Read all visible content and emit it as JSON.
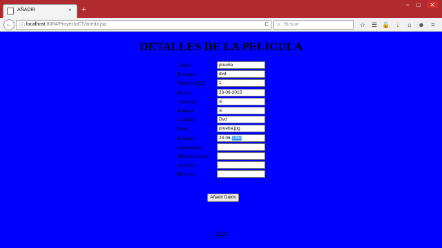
{
  "browser": {
    "tab_title": "AÑADIR",
    "tab_close": "×",
    "new_tab": "+",
    "url_host": "localhost",
    "url_path": ":8084/ProyectoCT/anedir.jsp",
    "search_placeholder": "Buscar",
    "window_buttons": {
      "minimize": "−",
      "maximize": "□",
      "close": "✕"
    }
  },
  "icons": {
    "back": "←",
    "info": "ⓘ",
    "reload": "C",
    "search": "⌕",
    "bookmark": "☆",
    "reading": "☰",
    "lock": "🔒",
    "download": "↓",
    "home": "⌂",
    "pocket": "☻",
    "menu": "≡"
  },
  "page": {
    "title": "DETALLES DE LA PELICULA",
    "submit_label": "Añadir Datos",
    "back_link": "Inicio"
  },
  "form": {
    "fields": [
      {
        "label": "Titulo:",
        "value": "prueba"
      },
      {
        "label": "Formato:",
        "value": "dvd"
      },
      {
        "label": "NumeroCDS:",
        "value": "1"
      },
      {
        "label": "Fecha:",
        "value": "23-06-2015"
      },
      {
        "label": "Caratula:",
        "value": "si"
      },
      {
        "label": "Imagen:",
        "value": "si"
      },
      {
        "label": "Calidad:",
        "value": "Dvd"
      },
      {
        "label": "Foto:",
        "value": "prueba.jpg"
      },
      {
        "label": "Estreno:",
        "value": "23-06-",
        "selected": "1980"
      },
      {
        "label": "Argumento:",
        "value": ""
      },
      {
        "label": "Observaciones:",
        "value": ""
      },
      {
        "label": "Actores:",
        "value": ""
      },
      {
        "label": "Director:",
        "value": ""
      }
    ]
  }
}
